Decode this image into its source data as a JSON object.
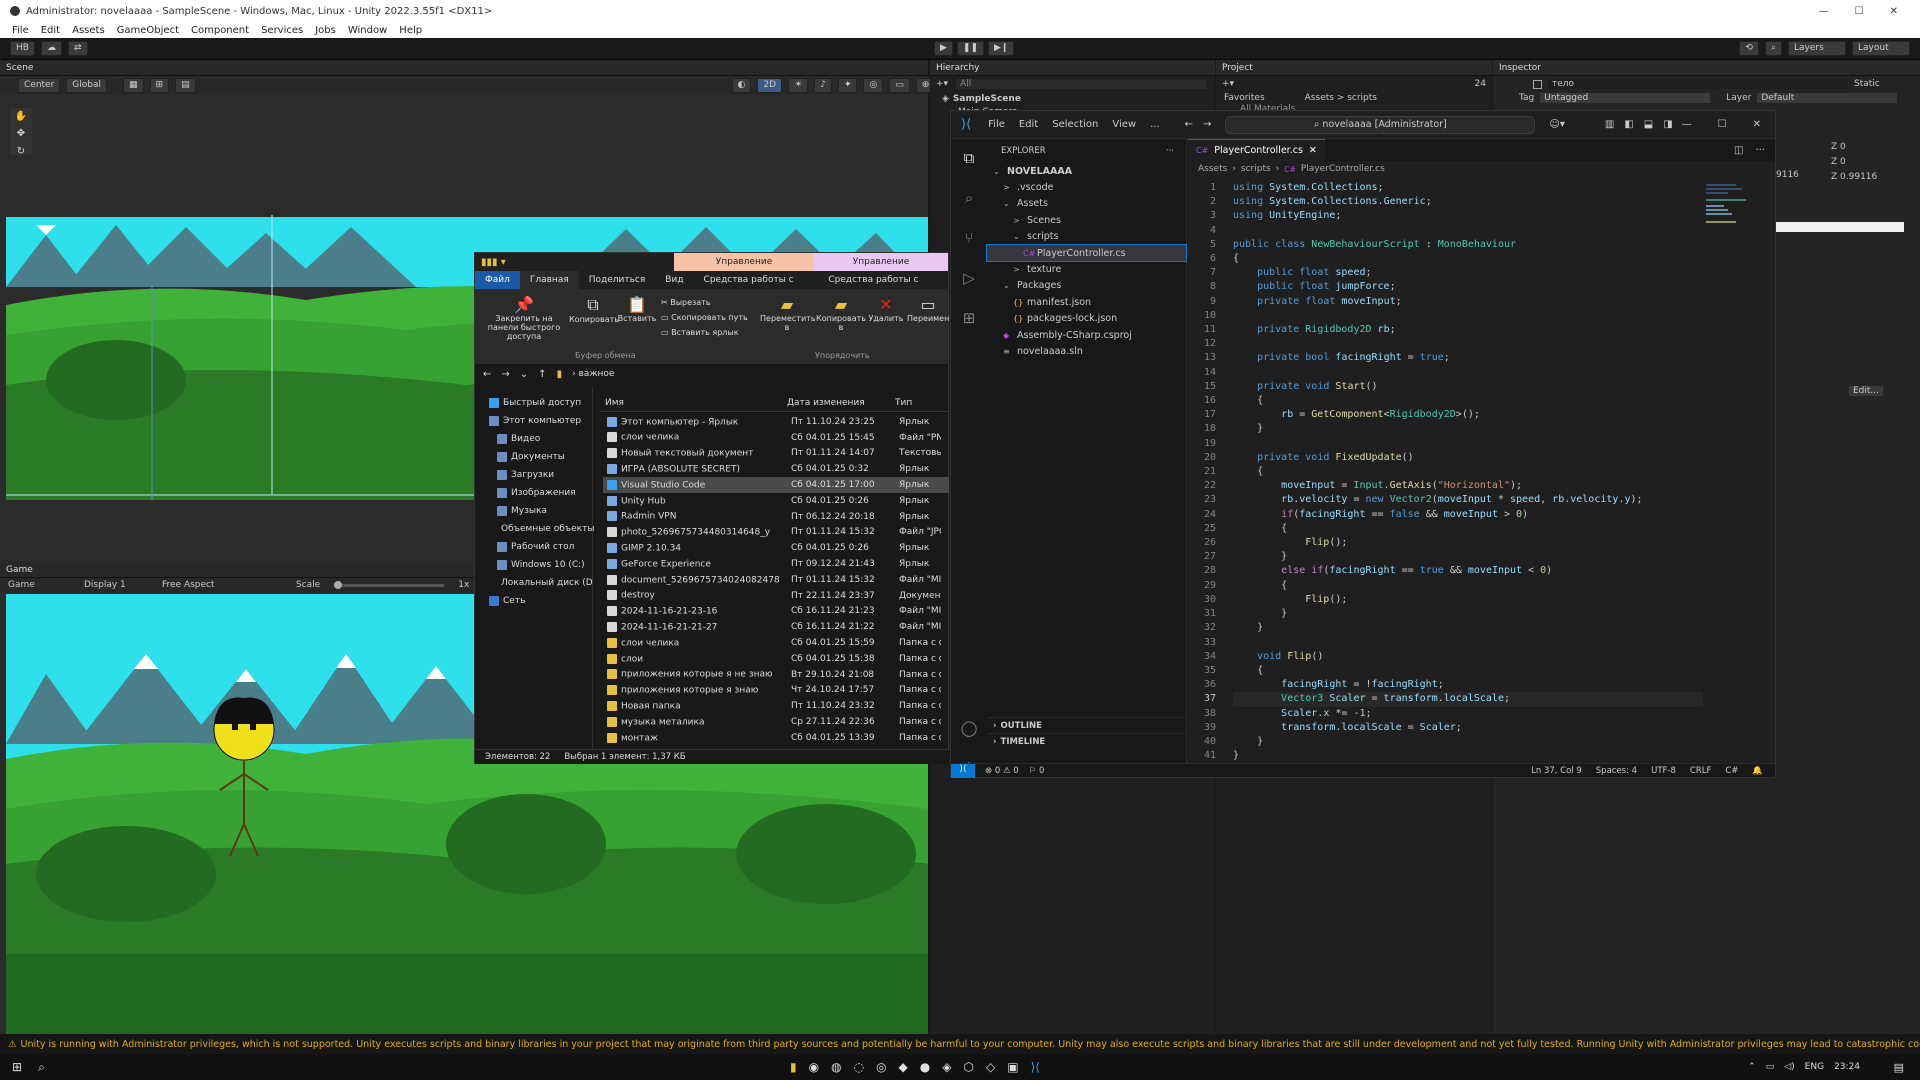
{
  "unity": {
    "title": "Administrator: novelaaaa - SampleScene - Windows, Mac, Linux - Unity 2022.3.55f1 <DX11>",
    "menu": [
      "File",
      "Edit",
      "Assets",
      "GameObject",
      "Component",
      "Services",
      "Jobs",
      "Window",
      "Help"
    ],
    "toolbar": {
      "account": "HB",
      "layers": "Layers",
      "layout": "Layout"
    },
    "scene": {
      "tab": "Scene",
      "pivot": "Center",
      "space": "Global",
      "mode_2d": "2D"
    },
    "game": {
      "tab": "Game",
      "view": "Game",
      "display": "Display 1",
      "aspect": "Free Aspect",
      "scale_label": "Scale",
      "scale_value": "1x"
    },
    "hierarchy": {
      "tab": "Hierarchy",
      "search": "All",
      "scene": "SampleScene",
      "item": "Main Camera"
    },
    "project": {
      "tab": "Project",
      "favorites": "Favorites",
      "fav_item": "All Materials",
      "breadcrumb": "Assets > scripts",
      "count": "24"
    },
    "inspector": {
      "tab": "Inspector",
      "object_name": "тело",
      "static": "Static",
      "tag_label": "Tag",
      "tag": "Untagged",
      "layer_label": "Layer",
      "layer": "Default",
      "z1": "Z  0",
      "z2": "Z  0",
      "v1": "9116",
      "v2": "Z  0.99116",
      "edit": "Edit..."
    },
    "status_warning": "Unity is running with Administrator privileges, which is not supported. Unity executes scripts and binary libraries in your project that may originate from third party sources and potentially be harmful to your computer. Unity may also execute scripts and binary libraries that are still under development and not yet fully tested. Running Unity with Administrator privileges may lead to catastrophic consequences, including but not limited"
  },
  "explorer": {
    "manage1": "Управление",
    "manage2": "Управление",
    "tabs": [
      "Файл",
      "Главная",
      "Поделиться",
      "Вид",
      "Средства работы с ярлыками",
      "Средства работы с приложени"
    ],
    "ribbon": {
      "pin": "Закрепить на панели быстрого доступа",
      "copy": "Копировать",
      "paste": "Вставить",
      "cut": "Вырезать",
      "copy_path": "Скопировать путь",
      "paste_shortcut": "Вставить ярлык",
      "move": "Переместить в",
      "copy_to": "Копировать в",
      "delete": "Удалить",
      "rename": "Переимен",
      "group_clipboard": "Буфер обмена",
      "group_organize": "Упорядочить"
    },
    "address": "важное",
    "columns": {
      "name": "Имя",
      "date": "Дата изменения",
      "type": "Тип"
    },
    "nav": [
      "Быстрый доступ",
      "Этот компьютер",
      "Видео",
      "Документы",
      "Загрузки",
      "Изображения",
      "Музыка",
      "Объемные объекты",
      "Рабочий стол",
      "Windows 10 (C:)",
      "Локальный диск (D",
      "Сеть"
    ],
    "files": [
      {
        "name": "Этот компьютер - Ярлык",
        "date": "Пт 11.10.24 23:25",
        "type": "Ярлык",
        "icon": "shortcut"
      },
      {
        "name": "слои челика",
        "date": "Сб 04.01.25 15:45",
        "type": "Файл \"PN",
        "icon": "file"
      },
      {
        "name": "Новый текстовый документ",
        "date": "Пт 01.11.24 14:07",
        "type": "Текстовы",
        "icon": "file"
      },
      {
        "name": "ИГРА (ABSOLUTE SECRET)",
        "date": "Сб 04.01.25 0:32",
        "type": "Ярлык",
        "icon": "shortcut"
      },
      {
        "name": "Visual Studio Code",
        "date": "Сб 04.01.25 17:00",
        "type": "Ярлык",
        "icon": "vscode",
        "selected": true
      },
      {
        "name": "Unity Hub",
        "date": "Сб 04.01.25 0:26",
        "type": "Ярлык",
        "icon": "shortcut"
      },
      {
        "name": "Radmin VPN",
        "date": "Пт 06.12.24 20:18",
        "type": "Ярлык",
        "icon": "shortcut"
      },
      {
        "name": "photo_5269675734480314648_y",
        "date": "Пт 01.11.24 15:32",
        "type": "Файл \"JPG",
        "icon": "file"
      },
      {
        "name": "GIMP 2.10.34",
        "date": "Сб 04.01.25 0:26",
        "type": "Ярлык",
        "icon": "shortcut"
      },
      {
        "name": "GeForce Experience",
        "date": "Пт 09.12.24 21:43",
        "type": "Ярлык",
        "icon": "shortcut"
      },
      {
        "name": "document_5269675734024082478",
        "date": "Пт 01.11.24 15:32",
        "type": "Файл \"MI",
        "icon": "file"
      },
      {
        "name": "destroy",
        "date": "Пт 22.11.24 23:37",
        "type": "Докумен",
        "icon": "file"
      },
      {
        "name": "2024-11-16-21-23-16",
        "date": "Сб 16.11.24 21:23",
        "type": "Файл \"MI",
        "icon": "file"
      },
      {
        "name": "2024-11-16-21-21-27",
        "date": "Сб 16.11.24 21:22",
        "type": "Файл \"MI",
        "icon": "file"
      },
      {
        "name": "слои челика",
        "date": "Сб 04.01.25 15:59",
        "type": "Папка с ф",
        "icon": "folder"
      },
      {
        "name": "слои",
        "date": "Сб 04.01.25 15:38",
        "type": "Папка с ф",
        "icon": "folder"
      },
      {
        "name": "приложения которые я не знаю",
        "date": "Вт 29.10.24 21:08",
        "type": "Папка с ф",
        "icon": "folder"
      },
      {
        "name": "приложения которые я знаю",
        "date": "Чт 24.10.24 17:57",
        "type": "Папка с ф",
        "icon": "folder"
      },
      {
        "name": "Новая папка",
        "date": "Пт 11.10.24 23:32",
        "type": "Папка с ф",
        "icon": "folder"
      },
      {
        "name": "музыка металика",
        "date": "Ср 27.11.24 22:36",
        "type": "Папка с ф",
        "icon": "folder"
      },
      {
        "name": "монтаж",
        "date": "Сб 04.01.25 13:39",
        "type": "Папка с ф",
        "icon": "folder"
      }
    ],
    "status_count": "Элементов: 22",
    "status_selected": "Выбран 1 элемент: 1,37 КБ"
  },
  "vscode": {
    "menu": [
      "File",
      "Edit",
      "Selection",
      "View",
      "..."
    ],
    "search": "novelaaaa [Administrator]",
    "explorer_title": "EXPLORER",
    "tab": "PlayerController.cs",
    "breadcrumb": [
      "Assets",
      "scripts",
      "PlayerController.cs"
    ],
    "tree": [
      {
        "label": "NOVELAAAA",
        "indent": 0,
        "arrow": "v",
        "bold": true
      },
      {
        "label": ".vscode",
        "indent": 1,
        "arrow": ">"
      },
      {
        "label": "Assets",
        "indent": 1,
        "arrow": "v"
      },
      {
        "label": "Scenes",
        "indent": 2,
        "arrow": ">"
      },
      {
        "label": "scripts",
        "indent": 2,
        "arrow": "v"
      },
      {
        "label": "PlayerController.cs",
        "indent": 3,
        "arrow": "C#",
        "selected": true
      },
      {
        "label": "texture",
        "indent": 2,
        "arrow": ">"
      },
      {
        "label": "Packages",
        "indent": 1,
        "arrow": "v"
      },
      {
        "label": "manifest.json",
        "indent": 2,
        "arrow": "{}"
      },
      {
        "label": "packages-lock.json",
        "indent": 2,
        "arrow": "{}"
      },
      {
        "label": "Assembly-CSharp.csproj",
        "indent": 1,
        "arrow": "◆"
      },
      {
        "label": "novelaaaa.sln",
        "indent": 1,
        "arrow": "≡"
      }
    ],
    "outline": "OUTLINE",
    "timeline": "TIMELINE",
    "code": [
      "using System.Collections;",
      "using System.Collections.Generic;",
      "using UnityEngine;",
      "",
      "public class NewBehaviourScript : MonoBehaviour",
      "{",
      "    public float speed;",
      "    public float jumpForce;",
      "    private float moveInput;",
      "",
      "    private Rigidbody2D rb;",
      "",
      "    private bool facingRight = true;",
      "",
      "    private void Start()",
      "    {",
      "        rb = GetComponent<Rigidbody2D>();",
      "    }",
      "",
      "    private void FixedUpdate()",
      "    {",
      "        moveInput = Input.GetAxis(\"Horizontal\");",
      "        rb.velocity = new Vector2(moveInput * speed, rb.velocity.y);",
      "        if(facingRight == false && moveInput > 0)",
      "        {",
      "            Flip();",
      "        }",
      "        else if(facingRight == true && moveInput < 0)",
      "        {",
      "            Flip();",
      "        }",
      "    }",
      "",
      "    void Flip()",
      "    {",
      "        facingRight = !facingRight;",
      "        Vector3 Scaler = transform.localScale;",
      "        Scaler.x *= -1;",
      "        transform.localScale = Scaler;",
      "    }",
      "}"
    ],
    "current_line": 37,
    "status": {
      "errors": "0",
      "warnings": "0",
      "ports": "0",
      "position": "Ln 37, Col 9",
      "spaces": "Spaces: 4",
      "encoding": "UTF-8",
      "eol": "CRLF",
      "lang": "C#"
    }
  },
  "taskbar": {
    "lang": "ENG",
    "time": "23:24"
  },
  "colors": {
    "sky": "#2ee0ec",
    "grass": "#3fb23a",
    "dark_grass": "#2a7a26",
    "mountain": "#4a7f8a",
    "accent": "#007acc"
  }
}
